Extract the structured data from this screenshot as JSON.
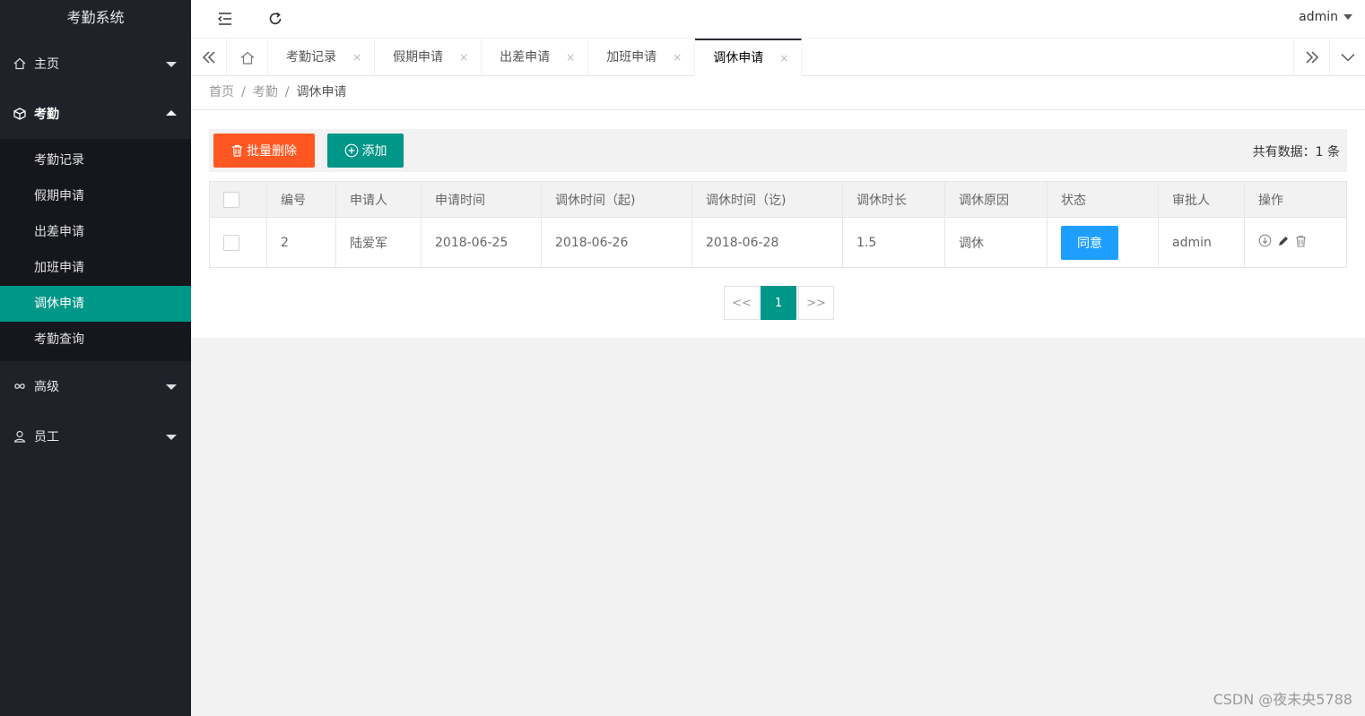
{
  "app": {
    "title": "考勤系统"
  },
  "sidebar": {
    "items": [
      {
        "label": "主页",
        "icon": "home-icon",
        "state": "collapsed"
      },
      {
        "label": "考勤",
        "icon": "cube-icon",
        "state": "expanded",
        "children": [
          {
            "label": "考勤记录"
          },
          {
            "label": "假期申请"
          },
          {
            "label": "出差申请"
          },
          {
            "label": "加班申请"
          },
          {
            "label": "调休申请",
            "active": true
          },
          {
            "label": "考勤查询"
          }
        ]
      },
      {
        "label": "高级",
        "icon": "infinity-icon",
        "state": "collapsed"
      },
      {
        "label": "员工",
        "icon": "user-icon",
        "state": "collapsed"
      }
    ]
  },
  "header": {
    "user": "admin"
  },
  "tabs": [
    {
      "label": "考勤记录"
    },
    {
      "label": "假期申请"
    },
    {
      "label": "出差申请"
    },
    {
      "label": "加班申请"
    },
    {
      "label": "调休申请",
      "active": true
    }
  ],
  "tab_close": "×",
  "breadcrumb": {
    "items": [
      "首页",
      "考勤",
      "调休申请"
    ],
    "separator": "/"
  },
  "toolbar": {
    "batch_delete": "批量删除",
    "add": "添加",
    "total": "共有数据：1 条"
  },
  "table": {
    "columns": [
      "编号",
      "申请人",
      "申请时间",
      "调休时间（起)",
      "调休时间（讫)",
      "调休时长",
      "调休原因",
      "状态",
      "审批人",
      "操作"
    ],
    "rows": [
      {
        "id": "2",
        "applicant": "陆爱军",
        "apply_time": "2018-06-25",
        "start": "2018-06-26",
        "end": "2018-06-28",
        "duration": "1.5",
        "reason": "调休",
        "status": "同意",
        "approver": "admin"
      }
    ]
  },
  "pager": {
    "prev": "<<",
    "current": "1",
    "next": ">>"
  },
  "watermark": "CSDN @夜未央5788",
  "colors": {
    "sidebar": "#20222a",
    "accent": "#009688",
    "danger": "#ff5722",
    "info": "#1e9fff"
  }
}
